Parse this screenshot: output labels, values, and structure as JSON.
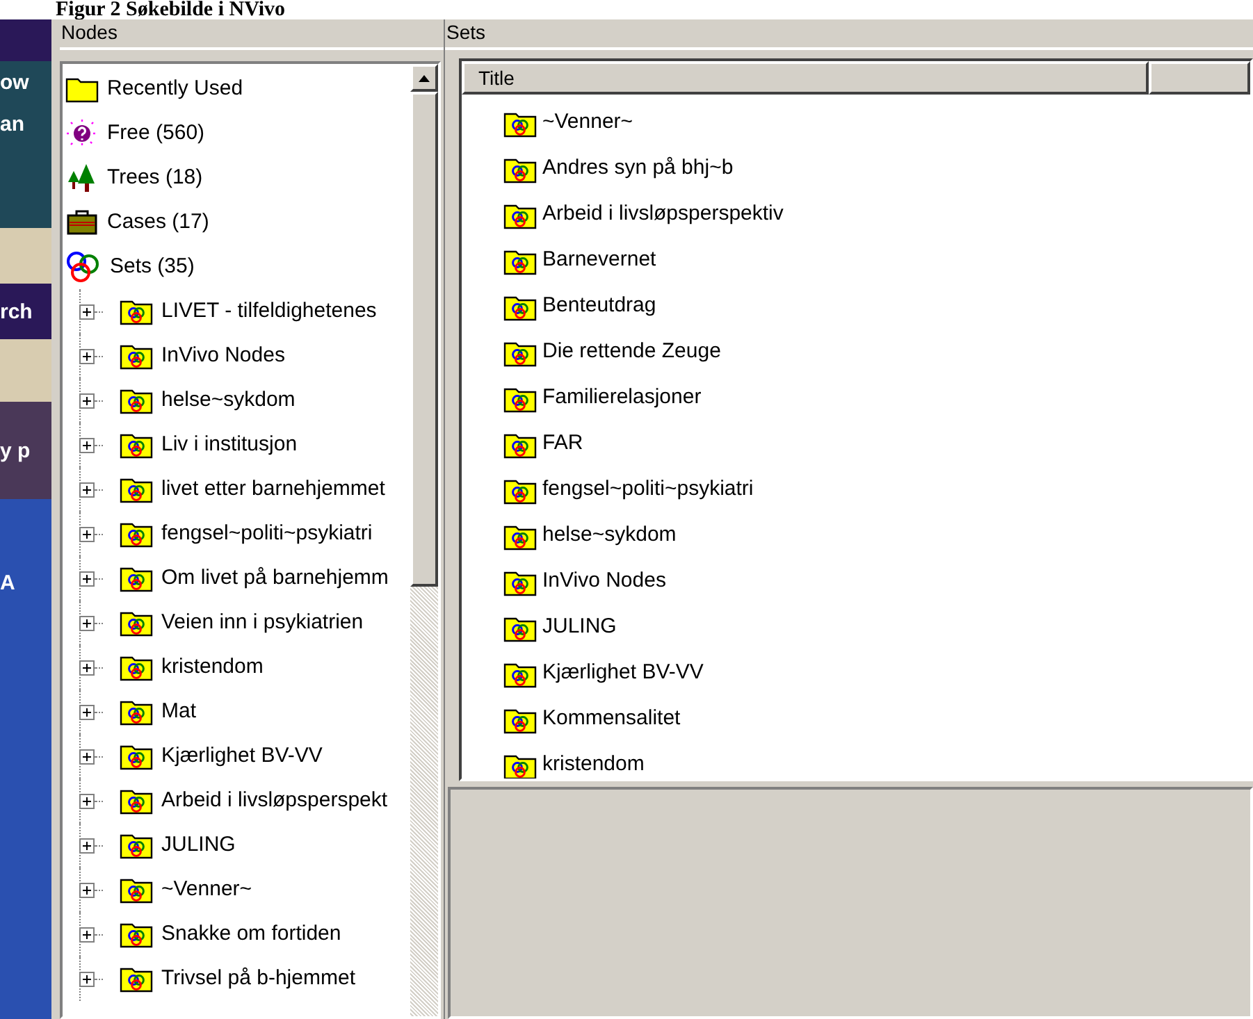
{
  "caption": "Figur 2 Søkebilde i NVivo",
  "background_window": {
    "texts": [
      "ow",
      "an",
      "rch",
      "y p",
      "A"
    ]
  },
  "nodes_panel": {
    "title": "Nodes",
    "items": [
      {
        "kind": "folder",
        "label": "Recently Used"
      },
      {
        "kind": "free",
        "label": "Free (560)"
      },
      {
        "kind": "trees",
        "label": "Trees (18)"
      },
      {
        "kind": "cases",
        "label": "Cases (17)"
      },
      {
        "kind": "sets",
        "label": "Sets (35)"
      },
      {
        "kind": "set",
        "label": "LIVET - tilfeldighetenes",
        "expanded": false
      },
      {
        "kind": "set",
        "label": "InVivo Nodes",
        "expanded": false
      },
      {
        "kind": "set",
        "label": "helse~sykdom",
        "expanded": false
      },
      {
        "kind": "set",
        "label": "Liv i institusjon",
        "expanded": false
      },
      {
        "kind": "set",
        "label": "livet etter barnehjemmet",
        "expanded": false
      },
      {
        "kind": "set",
        "label": "fengsel~politi~psykiatri",
        "expanded": false
      },
      {
        "kind": "set",
        "label": "Om livet på barnehjemm",
        "expanded": false
      },
      {
        "kind": "set",
        "label": "Veien inn i psykiatrien",
        "expanded": false
      },
      {
        "kind": "set",
        "label": "kristendom",
        "expanded": false
      },
      {
        "kind": "set",
        "label": "Mat",
        "expanded": false
      },
      {
        "kind": "set",
        "label": "Kjærlighet BV-VV",
        "expanded": false
      },
      {
        "kind": "set",
        "label": "Arbeid i livsløpsperspekt",
        "expanded": false
      },
      {
        "kind": "set",
        "label": "JULING",
        "expanded": false
      },
      {
        "kind": "set",
        "label": "~Venner~",
        "expanded": false
      },
      {
        "kind": "set",
        "label": "Snakke om fortiden",
        "expanded": false
      },
      {
        "kind": "set",
        "label": "Trivsel på b-hjemmet",
        "expanded": false
      }
    ]
  },
  "sets_panel": {
    "title": "Sets",
    "columns": [
      "Title"
    ],
    "rows": [
      "~Venner~",
      "Andres syn på bhj~b",
      "Arbeid i livsløpsperspektiv",
      "Barnevernet",
      "Benteutdrag",
      "Die rettende Zeuge",
      "Familierelasjoner",
      "FAR",
      "fengsel~politi~psykiatri",
      "helse~sykdom",
      "InVivo Nodes",
      "JULING",
      "Kjærlighet BV-VV",
      "Kommensalitet",
      "kristendom"
    ]
  }
}
